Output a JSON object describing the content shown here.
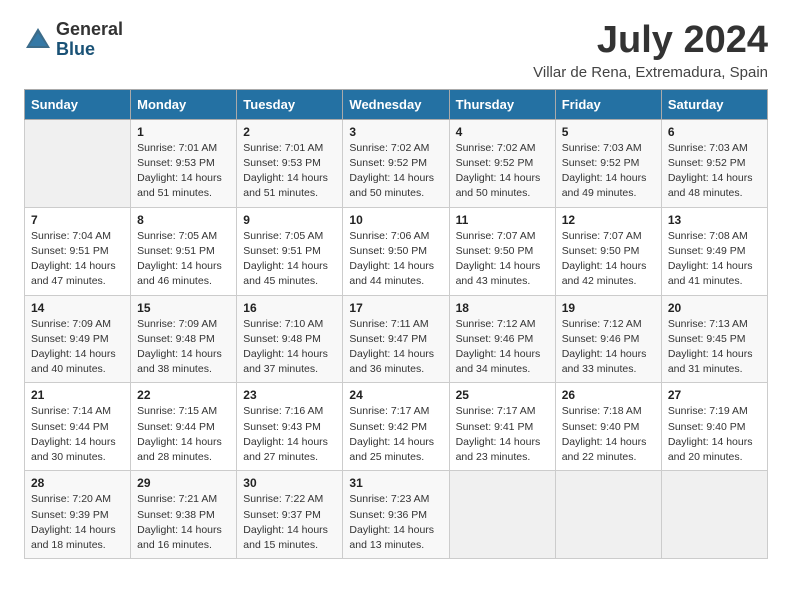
{
  "logo": {
    "general": "General",
    "blue": "Blue"
  },
  "title": "July 2024",
  "location": "Villar de Rena, Extremadura, Spain",
  "days_of_week": [
    "Sunday",
    "Monday",
    "Tuesday",
    "Wednesday",
    "Thursday",
    "Friday",
    "Saturday"
  ],
  "weeks": [
    [
      {
        "day": "",
        "content": ""
      },
      {
        "day": "1",
        "content": "Sunrise: 7:01 AM\nSunset: 9:53 PM\nDaylight: 14 hours and 51 minutes."
      },
      {
        "day": "2",
        "content": "Sunrise: 7:01 AM\nSunset: 9:53 PM\nDaylight: 14 hours and 51 minutes."
      },
      {
        "day": "3",
        "content": "Sunrise: 7:02 AM\nSunset: 9:52 PM\nDaylight: 14 hours and 50 minutes."
      },
      {
        "day": "4",
        "content": "Sunrise: 7:02 AM\nSunset: 9:52 PM\nDaylight: 14 hours and 50 minutes."
      },
      {
        "day": "5",
        "content": "Sunrise: 7:03 AM\nSunset: 9:52 PM\nDaylight: 14 hours and 49 minutes."
      },
      {
        "day": "6",
        "content": "Sunrise: 7:03 AM\nSunset: 9:52 PM\nDaylight: 14 hours and 48 minutes."
      }
    ],
    [
      {
        "day": "7",
        "content": "Sunrise: 7:04 AM\nSunset: 9:51 PM\nDaylight: 14 hours and 47 minutes."
      },
      {
        "day": "8",
        "content": "Sunrise: 7:05 AM\nSunset: 9:51 PM\nDaylight: 14 hours and 46 minutes."
      },
      {
        "day": "9",
        "content": "Sunrise: 7:05 AM\nSunset: 9:51 PM\nDaylight: 14 hours and 45 minutes."
      },
      {
        "day": "10",
        "content": "Sunrise: 7:06 AM\nSunset: 9:50 PM\nDaylight: 14 hours and 44 minutes."
      },
      {
        "day": "11",
        "content": "Sunrise: 7:07 AM\nSunset: 9:50 PM\nDaylight: 14 hours and 43 minutes."
      },
      {
        "day": "12",
        "content": "Sunrise: 7:07 AM\nSunset: 9:50 PM\nDaylight: 14 hours and 42 minutes."
      },
      {
        "day": "13",
        "content": "Sunrise: 7:08 AM\nSunset: 9:49 PM\nDaylight: 14 hours and 41 minutes."
      }
    ],
    [
      {
        "day": "14",
        "content": "Sunrise: 7:09 AM\nSunset: 9:49 PM\nDaylight: 14 hours and 40 minutes."
      },
      {
        "day": "15",
        "content": "Sunrise: 7:09 AM\nSunset: 9:48 PM\nDaylight: 14 hours and 38 minutes."
      },
      {
        "day": "16",
        "content": "Sunrise: 7:10 AM\nSunset: 9:48 PM\nDaylight: 14 hours and 37 minutes."
      },
      {
        "day": "17",
        "content": "Sunrise: 7:11 AM\nSunset: 9:47 PM\nDaylight: 14 hours and 36 minutes."
      },
      {
        "day": "18",
        "content": "Sunrise: 7:12 AM\nSunset: 9:46 PM\nDaylight: 14 hours and 34 minutes."
      },
      {
        "day": "19",
        "content": "Sunrise: 7:12 AM\nSunset: 9:46 PM\nDaylight: 14 hours and 33 minutes."
      },
      {
        "day": "20",
        "content": "Sunrise: 7:13 AM\nSunset: 9:45 PM\nDaylight: 14 hours and 31 minutes."
      }
    ],
    [
      {
        "day": "21",
        "content": "Sunrise: 7:14 AM\nSunset: 9:44 PM\nDaylight: 14 hours and 30 minutes."
      },
      {
        "day": "22",
        "content": "Sunrise: 7:15 AM\nSunset: 9:44 PM\nDaylight: 14 hours and 28 minutes."
      },
      {
        "day": "23",
        "content": "Sunrise: 7:16 AM\nSunset: 9:43 PM\nDaylight: 14 hours and 27 minutes."
      },
      {
        "day": "24",
        "content": "Sunrise: 7:17 AM\nSunset: 9:42 PM\nDaylight: 14 hours and 25 minutes."
      },
      {
        "day": "25",
        "content": "Sunrise: 7:17 AM\nSunset: 9:41 PM\nDaylight: 14 hours and 23 minutes."
      },
      {
        "day": "26",
        "content": "Sunrise: 7:18 AM\nSunset: 9:40 PM\nDaylight: 14 hours and 22 minutes."
      },
      {
        "day": "27",
        "content": "Sunrise: 7:19 AM\nSunset: 9:40 PM\nDaylight: 14 hours and 20 minutes."
      }
    ],
    [
      {
        "day": "28",
        "content": "Sunrise: 7:20 AM\nSunset: 9:39 PM\nDaylight: 14 hours and 18 minutes."
      },
      {
        "day": "29",
        "content": "Sunrise: 7:21 AM\nSunset: 9:38 PM\nDaylight: 14 hours and 16 minutes."
      },
      {
        "day": "30",
        "content": "Sunrise: 7:22 AM\nSunset: 9:37 PM\nDaylight: 14 hours and 15 minutes."
      },
      {
        "day": "31",
        "content": "Sunrise: 7:23 AM\nSunset: 9:36 PM\nDaylight: 14 hours and 13 minutes."
      },
      {
        "day": "",
        "content": ""
      },
      {
        "day": "",
        "content": ""
      },
      {
        "day": "",
        "content": ""
      }
    ]
  ]
}
